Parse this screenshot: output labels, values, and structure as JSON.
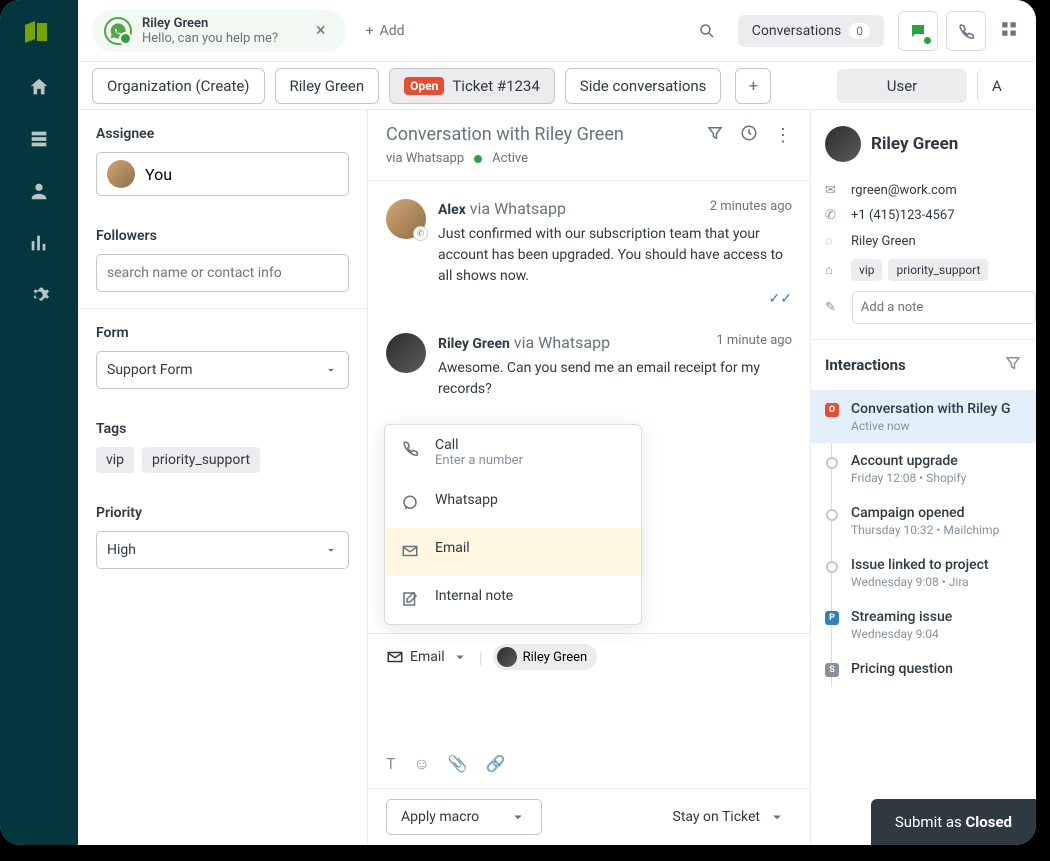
{
  "topbar": {
    "tab_chip": {
      "name": "Riley Green",
      "subtitle": "Hello, can you help me?"
    },
    "add_label": "Add",
    "conversations_label": "Conversations",
    "conversations_count": "0"
  },
  "subtabs": {
    "org": "Organization (Create)",
    "requester": "Riley Green",
    "open_badge": "Open",
    "ticket": "Ticket #1234",
    "side": "Side conversations",
    "user": "User",
    "cut": "A"
  },
  "props": {
    "assignee_label": "Assignee",
    "assignee_value": "You",
    "followers_label": "Followers",
    "followers_placeholder": "search name or contact info",
    "form_label": "Form",
    "form_value": "Support Form",
    "tags_label": "Tags",
    "tags": [
      "vip",
      "priority_support"
    ],
    "priority_label": "Priority",
    "priority_value": "High"
  },
  "conv": {
    "title": "Conversation with Riley Green",
    "via": "via Whatsapp",
    "status": "Active",
    "messages": [
      {
        "author": "Alex",
        "via": "via Whatsapp",
        "ts": "2 minutes ago",
        "text": "Just confirmed with our subscription team that your account has been upgraded. You should have access to all shows now."
      },
      {
        "author": "Riley Green",
        "via": "via Whatsapp",
        "ts": "1 minute ago",
        "text": "Awesome. Can you send me an email receipt for my records?"
      }
    ]
  },
  "popover": {
    "call": "Call",
    "call_sub": "Enter a number",
    "whatsapp": "Whatsapp",
    "email": "Email",
    "note": "Internal note"
  },
  "composer": {
    "channel": "Email",
    "to": "Riley Green"
  },
  "footer": {
    "macro": "Apply macro",
    "stay": "Stay on Ticket"
  },
  "user_panel": {
    "name": "Riley Green",
    "email": "rgreen@work.com",
    "phone": "+1 (415)123-4567",
    "whatsapp": "Riley Green",
    "tags": [
      "vip",
      "priority_support"
    ],
    "note_placeholder": "Add a note"
  },
  "interactions": {
    "title": "Interactions",
    "items": [
      {
        "bul": "O",
        "cls": "o",
        "title": "Conversation with Riley G",
        "sub": "Active now",
        "active": true
      },
      {
        "bul": "",
        "cls": "c",
        "title": "Account upgrade",
        "sub": "Friday 12:08 • Shopify"
      },
      {
        "bul": "",
        "cls": "c",
        "title": "Campaign opened",
        "sub": "Thursday 10:32 • Mailchimp"
      },
      {
        "bul": "",
        "cls": "c",
        "title": "Issue linked to project",
        "sub": "Wednesday 9:08 • Jira"
      },
      {
        "bul": "P",
        "cls": "p",
        "title": "Streaming issue",
        "sub": "Wednesday 9:04"
      },
      {
        "bul": "S",
        "cls": "s",
        "title": "Pricing question",
        "sub": ""
      }
    ]
  },
  "submit": {
    "prefix": "Submit as ",
    "status": "Closed"
  }
}
